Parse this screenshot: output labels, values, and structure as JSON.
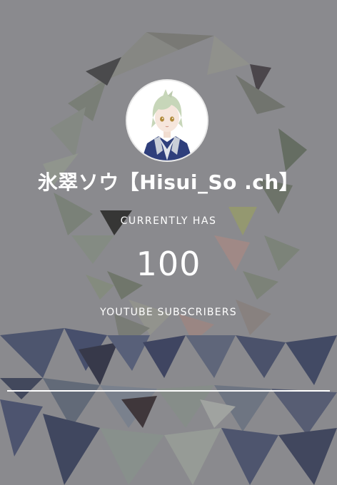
{
  "channel": {
    "name": "氷翠ソウ【Hisui_So .ch】",
    "avatar_icon": "anime-avatar-icon"
  },
  "counter": {
    "prefix": "CURRENTLY HAS",
    "value": "100",
    "suffix": "YOUTUBE SUBSCRIBERS"
  },
  "colors": {
    "text": "#ffffff",
    "background": "#929295",
    "divider": "#ffffff"
  }
}
